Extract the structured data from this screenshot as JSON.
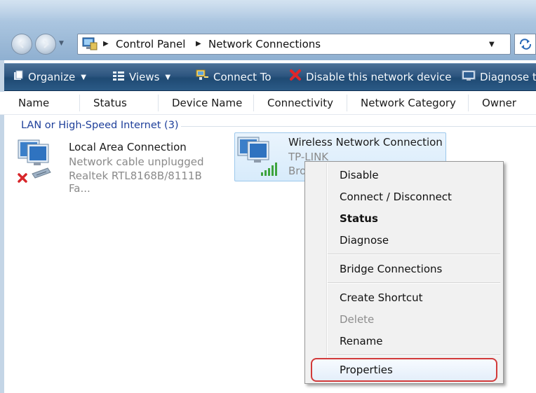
{
  "address_bar": {
    "breadcrumbs": [
      "Control Panel",
      "Network Connections"
    ]
  },
  "toolbar": {
    "organize": "Organize",
    "views": "Views",
    "connect_to": "Connect To",
    "disable_device": "Disable this network device",
    "diagnose": "Diagnose t"
  },
  "columns": [
    "Name",
    "Status",
    "Device Name",
    "Connectivity",
    "Network Category",
    "Owner"
  ],
  "group": {
    "header": "LAN or High-Speed Internet (3)"
  },
  "connections": [
    {
      "name": "Local Area Connection",
      "status": "Network cable unplugged",
      "device": "Realtek RTL8168B/8111B Fa..."
    },
    {
      "name": "Wireless Network Connection",
      "status": "TP-LINK",
      "device": "Bro"
    }
  ],
  "context_menu": {
    "items": [
      {
        "label": "Disable",
        "style": "normal"
      },
      {
        "label": "Connect / Disconnect",
        "style": "normal"
      },
      {
        "label": "Status",
        "style": "bold"
      },
      {
        "label": "Diagnose",
        "style": "normal"
      },
      {
        "label": "Bridge Connections",
        "style": "normal"
      },
      {
        "label": "Create Shortcut",
        "style": "normal"
      },
      {
        "label": "Delete",
        "style": "disabled"
      },
      {
        "label": "Rename",
        "style": "normal"
      },
      {
        "label": "Properties",
        "style": "highlighted"
      }
    ]
  },
  "colors": {
    "toolbar": "#2e5680",
    "group_header": "#1e3f9a",
    "highlight_border": "#d23a3a"
  }
}
